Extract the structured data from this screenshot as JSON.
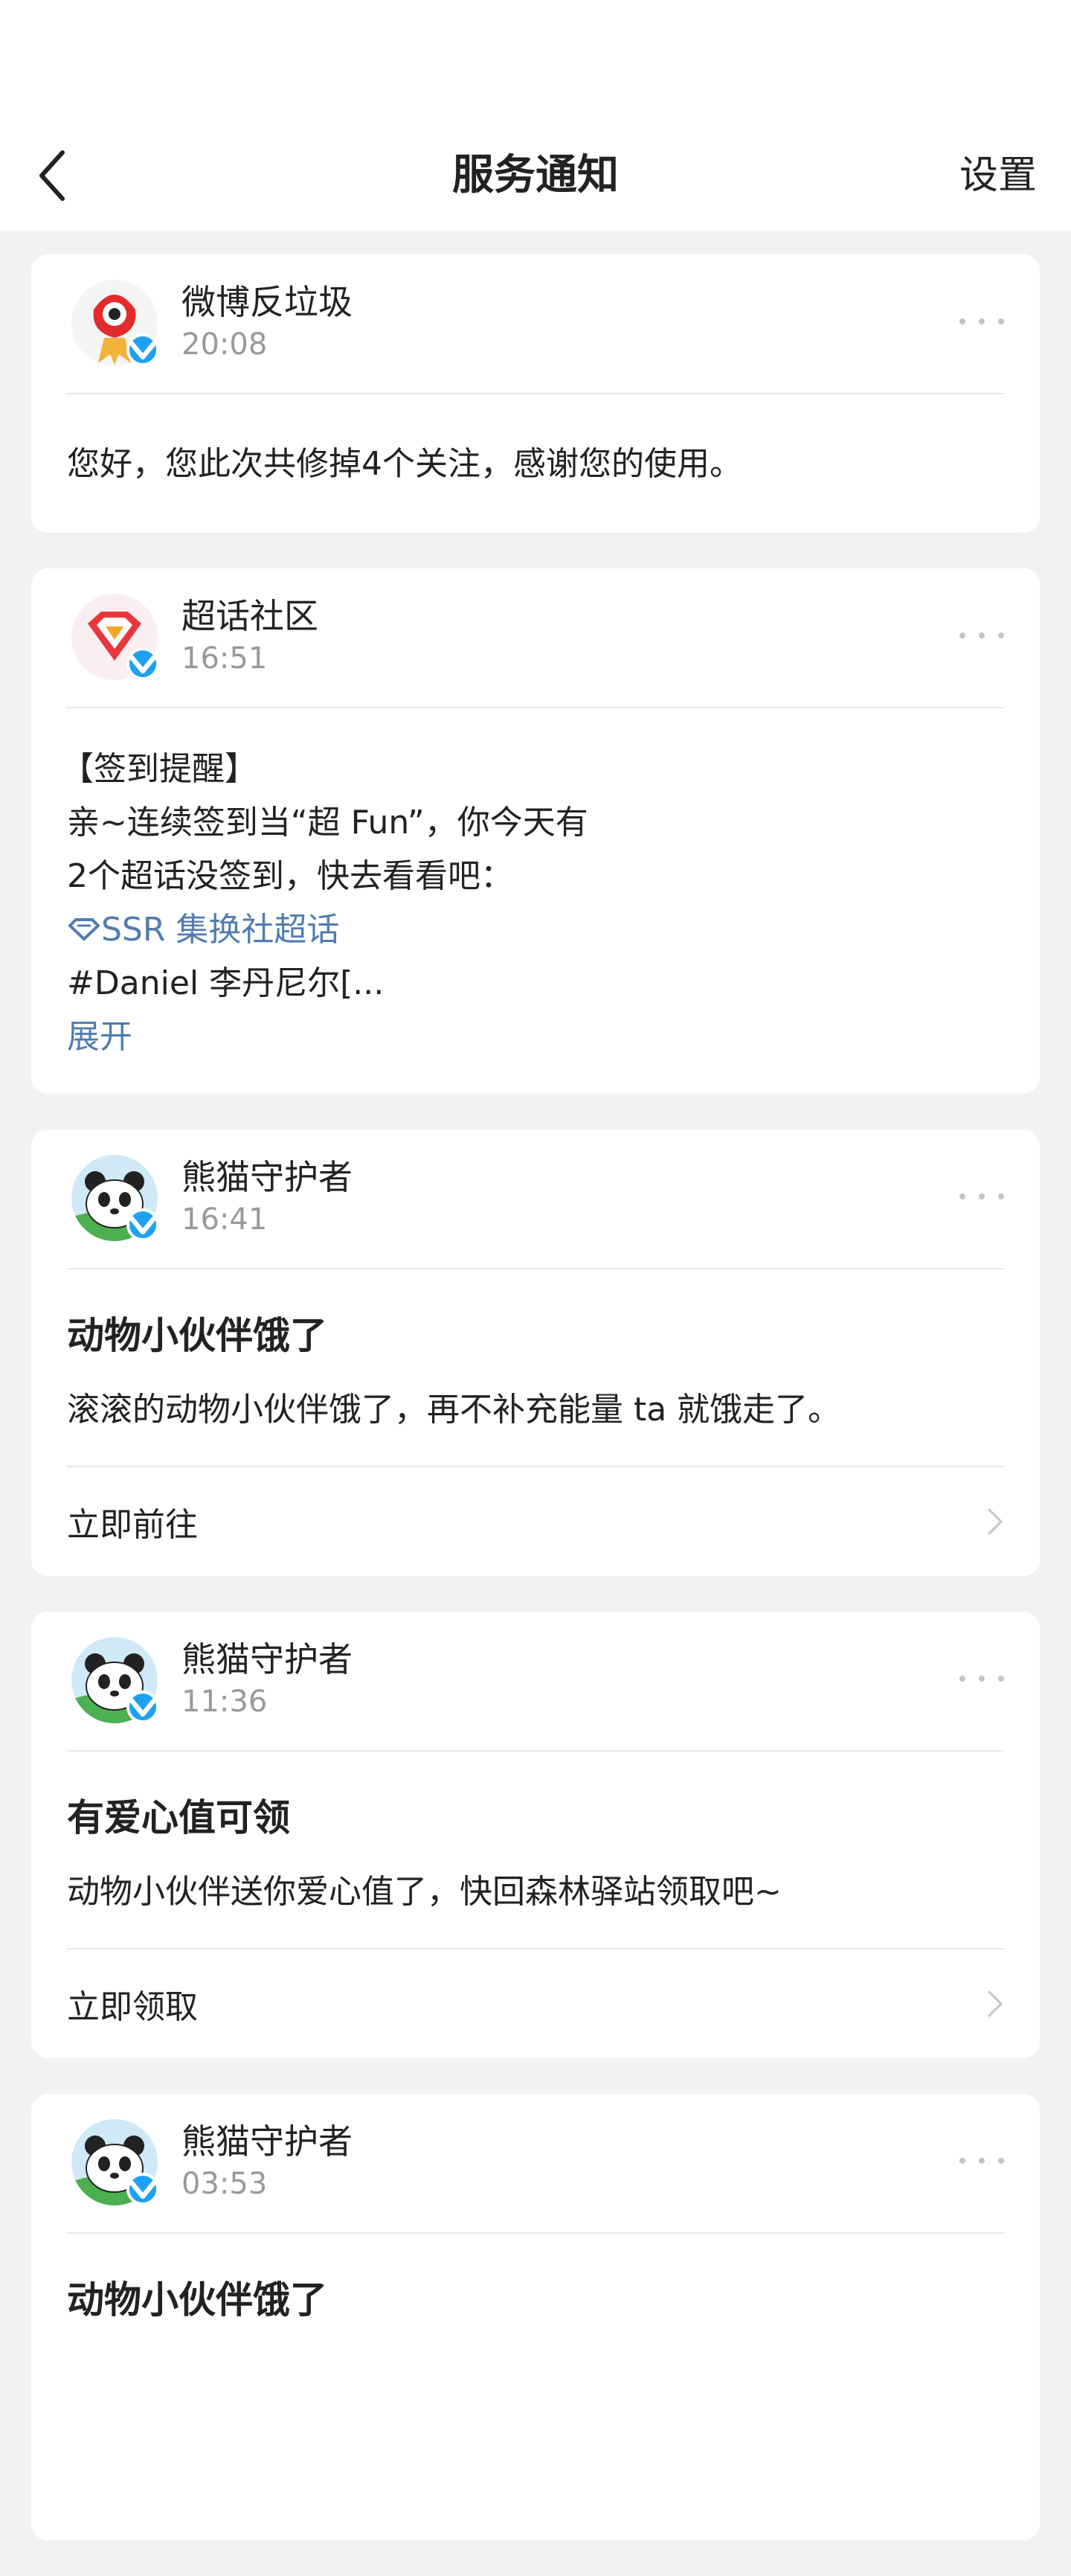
{
  "header": {
    "title": "服务通知",
    "settings_label": "设置"
  },
  "cards": [
    {
      "sender": "微博反垃圾",
      "time": "20:08",
      "avatar_icon": "weibo-eye-logo-icon",
      "text": "您好，您此次共修掉4个关注，感谢您的使用。"
    },
    {
      "sender": "超话社区",
      "time": "16:51",
      "avatar_icon": "super-topic-diamond-logo-icon",
      "lines": [
        "【签到提醒】",
        "亲~连续签到当“超 Fun”，你今天有",
        "2个超话没签到，快去看看吧："
      ],
      "link_text": "SSR 集换社超话",
      "hashtag_line": "#Daniel 李丹尼尔[...",
      "expand_label": "展开"
    },
    {
      "sender": "熊猫守护者",
      "time": "16:41",
      "avatar_icon": "panda-icon",
      "title": "动物小伙伴饿了",
      "desc": "滚滚的动物小伙伴饿了，再不补充能量 ta 就饿走了。",
      "action": "立即前往"
    },
    {
      "sender": "熊猫守护者",
      "time": "11:36",
      "avatar_icon": "panda-icon",
      "title": "有爱心值可领",
      "desc": "动物小伙伴送你爱心值了，快回森林驿站领取吧~",
      "action": "立即领取"
    },
    {
      "sender": "熊猫守护者",
      "time": "03:53",
      "avatar_icon": "panda-icon",
      "title": "动物小伙伴饿了"
    }
  ],
  "colors": {
    "link": "#507daf",
    "verified_badge": "#1da1f2",
    "background": "#f2f2f2"
  }
}
